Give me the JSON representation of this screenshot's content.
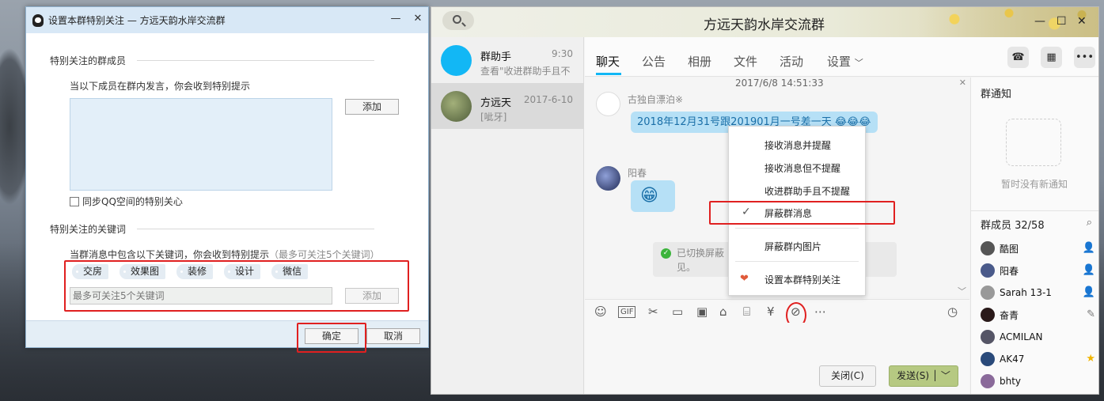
{
  "dialog": {
    "title": "设置本群特别关注 — 方远天韵水岸交流群",
    "section_members": "特别关注的群成员",
    "members_hint": "当以下成员在群内发言，你会收到特别提示",
    "add_member_label": "添加",
    "sync_qzone_label": "同步QQ空间的特别关心",
    "section_keywords": "特别关注的关键词",
    "keywords_hint": "当群消息中包含以下关键词，你会收到特别提示",
    "keywords_limit": "（最多可关注5个关键词）",
    "keywords": [
      "交房",
      "效果图",
      "装修",
      "设计",
      "微信"
    ],
    "keyword_input_value": "最多可关注5个关键词",
    "add_keyword_label": "添加",
    "ok_label": "确定",
    "cancel_label": "取消"
  },
  "main": {
    "title": "方远天韵水岸交流群",
    "contacts": [
      {
        "name": "群助手",
        "time": "9:30",
        "sub": "查看\"收进群助手且不",
        "color": "#12b7f5"
      },
      {
        "name": "方远天",
        "time": "2017-6-10",
        "sub": "[呲牙]",
        "color": "#6d7a4e"
      }
    ],
    "tabs": [
      "聊天",
      "公告",
      "相册",
      "文件",
      "活动",
      "设置"
    ],
    "timestamp": "2017/6/8 14:51:33",
    "messages": [
      {
        "sender": "古独自漂泊※",
        "text": "2018年12月31号跟201901月一号差一天"
      },
      {
        "sender": "阳春",
        "text": ""
      }
    ],
    "notice": {
      "text_a": "已切换屏蔽",
      "text_b": "人可",
      "text_c": "见。"
    },
    "close_label": "关闭(C)",
    "send_label": "发送(S)",
    "sidebar": {
      "notice_title": "群通知",
      "notice_empty": "暂时没有新通知",
      "members_title": "群成员 32/58",
      "members": [
        {
          "name": "酷图",
          "color": "#555",
          "role": "👤"
        },
        {
          "name": "阳春",
          "color": "#4a5a8a",
          "role": "👤"
        },
        {
          "name": "Sarah 13-1",
          "color": "#999",
          "role": "👤"
        },
        {
          "name": "奋青",
          "color": "#2a1a1a",
          "role": "✎"
        },
        {
          "name": "ACMILAN",
          "color": "#556",
          "role": ""
        },
        {
          "name": "AK47",
          "color": "#2a4a7a",
          "role": "★"
        },
        {
          "name": "bhty",
          "color": "#8a6a9a",
          "role": ""
        }
      ]
    },
    "menu": [
      "接收消息并提醒",
      "接收消息但不提醒",
      "收进群助手且不提醒",
      "屏蔽群消息",
      "屏蔽群内图片",
      "设置本群特别关注"
    ],
    "menu_checked_index": 3
  }
}
